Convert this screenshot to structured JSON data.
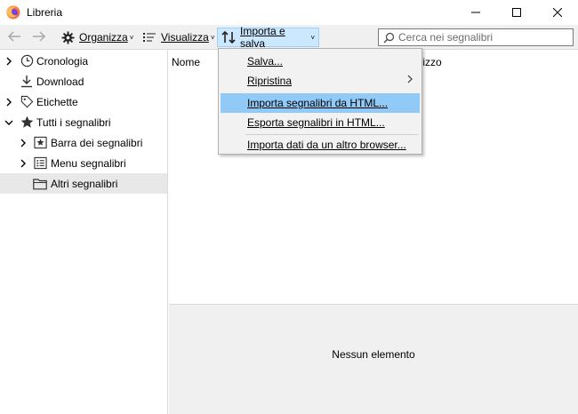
{
  "window": {
    "title": "Libreria",
    "minimize_icon": "minimize-icon",
    "maximize_icon": "maximize-icon",
    "close_icon": "close-icon"
  },
  "toolbar": {
    "back_icon": "arrow-left-icon",
    "forward_icon": "arrow-right-icon",
    "organize": {
      "label": "Organizza",
      "icon": "gear-icon"
    },
    "view": {
      "label": "Visualizza",
      "icon": "list-icon"
    },
    "import_save": {
      "label": "Importa e salva",
      "icon": "import-export-icon"
    },
    "search": {
      "placeholder": "Cerca nei segnalibri",
      "value": ""
    }
  },
  "sidebar": {
    "items": [
      {
        "label": "Cronologia",
        "icon": "clock-icon",
        "twisty": "collapsed"
      },
      {
        "label": "Download",
        "icon": "download-icon",
        "twisty": "none"
      },
      {
        "label": "Etichette",
        "icon": "tag-icon",
        "twisty": "collapsed"
      },
      {
        "label": "Tutti i segnalibri",
        "icon": "star-icon",
        "twisty": "expanded"
      },
      {
        "label": "Barra dei segnalibri",
        "icon": "bookmark-toolbar-icon",
        "twisty": "collapsed"
      },
      {
        "label": "Menu segnalibri",
        "icon": "bookmark-menu-icon",
        "twisty": "collapsed"
      },
      {
        "label": "Altri segnalibri",
        "icon": "folder-icon",
        "twisty": "none",
        "selected": true
      }
    ]
  },
  "content": {
    "columns": [
      "Nome",
      "Indirizzo"
    ],
    "empty_message": "Nessun elemento"
  },
  "menu": {
    "items": [
      {
        "label": "Salva..."
      },
      {
        "label": "Ripristina",
        "submenu": true
      },
      {
        "label": "Importa segnalibri da HTML...",
        "highlighted": true
      },
      {
        "label": "Esporta segnalibri in HTML..."
      },
      {
        "label": "Importa dati da un altro browser..."
      }
    ]
  },
  "colors": {
    "active_button_bg": "#cce8ff",
    "menu_highlight": "#91c9f7",
    "toolbar_bg": "#f0f0f0"
  }
}
